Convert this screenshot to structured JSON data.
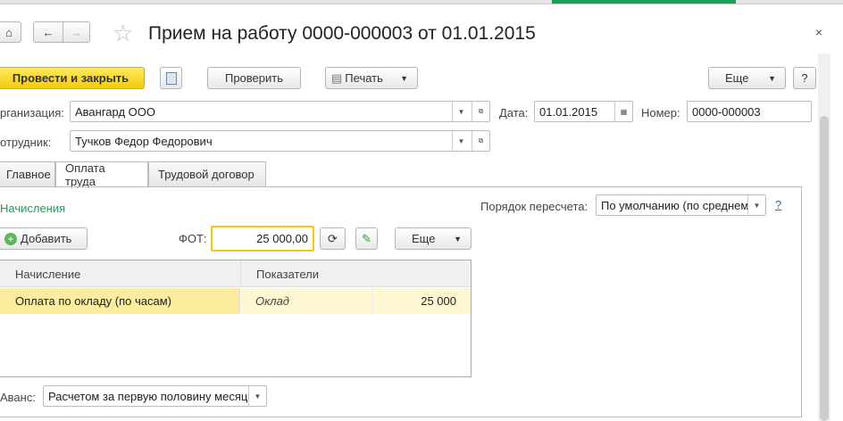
{
  "header": {
    "title": "Прием на работу 0000-000003 от 01.01.2015"
  },
  "toolbar": {
    "post_close": "Провести и закрыть",
    "check": "Проверить",
    "print": "Печать",
    "more": "Еще",
    "help": "?"
  },
  "fields": {
    "org_label": "рганизация:",
    "org_value": "Авангард ООО",
    "date_label": "Дата:",
    "date_value": "01.01.2015",
    "number_label": "Номер:",
    "number_value": "0000-000003",
    "employee_label": "отрудник:",
    "employee_value": "Тучков Федор Федорович"
  },
  "tabs": [
    {
      "label": "Главное"
    },
    {
      "label": "Оплата труда"
    },
    {
      "label": "Трудовой договор"
    }
  ],
  "pay": {
    "section": "Начисления",
    "recalc_label": "Порядок пересчета:",
    "recalc_value": "По умолчанию (по среднем",
    "recalc_help": "?",
    "add": "Добавить",
    "fot_label": "ФОТ:",
    "fot_value": "25 000,00",
    "more": "Еще",
    "columns": [
      "Начисление",
      "Показатели"
    ],
    "rows": [
      {
        "accrual": "Оплата по окладу (по часам)",
        "indicator": "Оклад",
        "value": "25 000"
      }
    ],
    "advance_label": "Аванс:",
    "advance_value": "Расчетом за первую половину месяц"
  },
  "colors": {
    "accent": "#f5d21a",
    "green": "#1a9e5a"
  }
}
